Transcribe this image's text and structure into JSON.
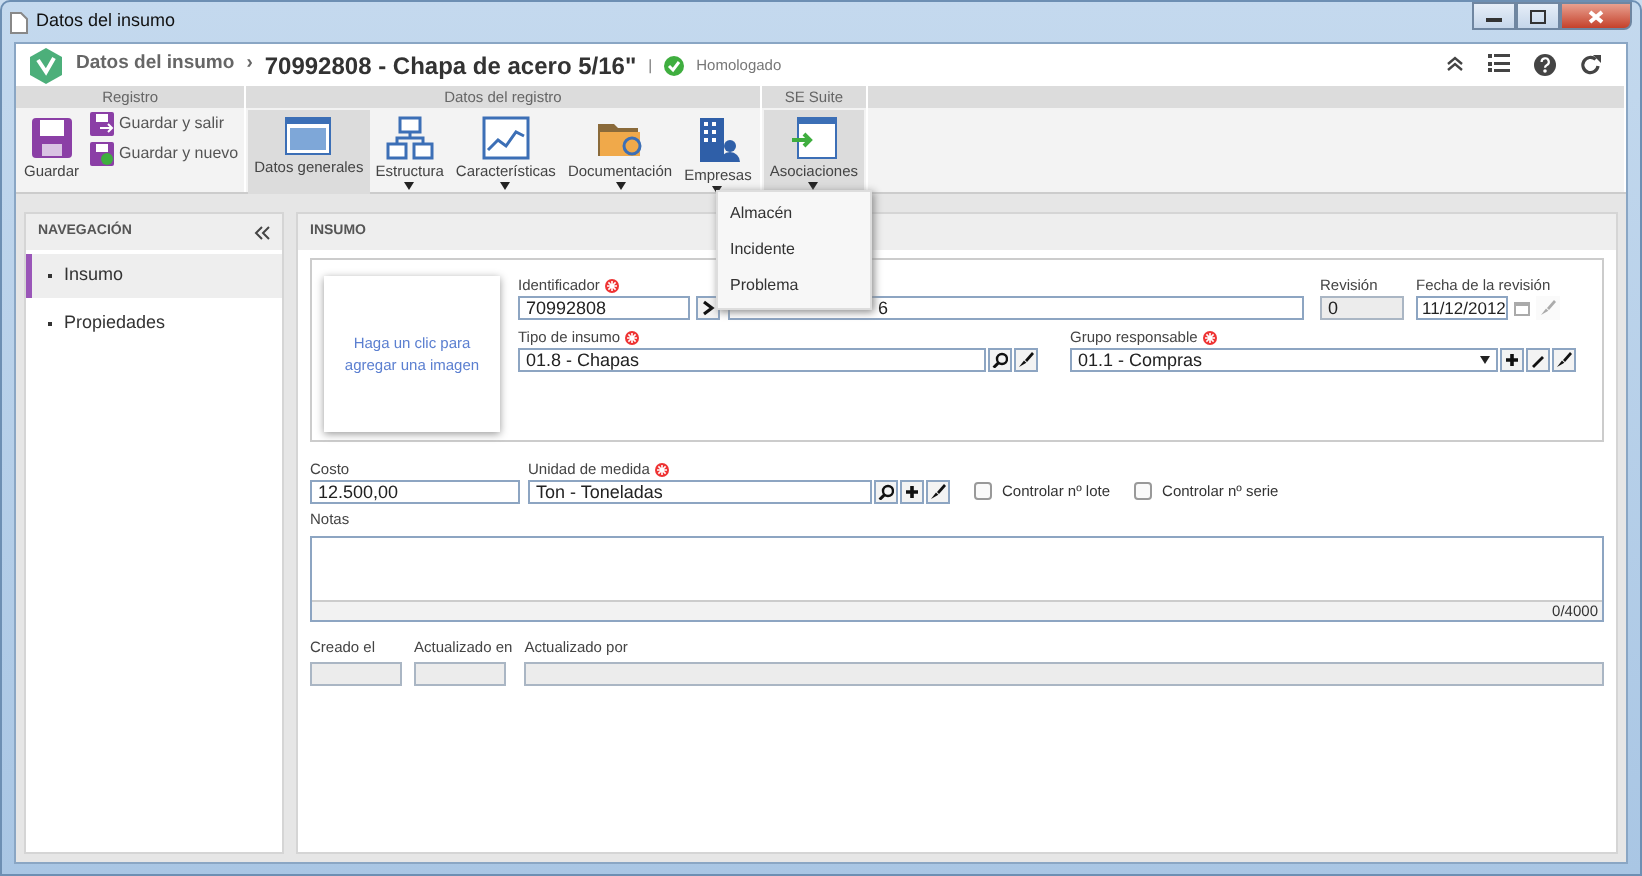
{
  "window": {
    "title": "Datos del insumo"
  },
  "header": {
    "breadcrumb": "Datos del insumo",
    "separator": "›",
    "title": "70992808 - Chapa de acero 5/16\"",
    "divider": "|",
    "status": "Homologado"
  },
  "ribbon": {
    "groups": [
      {
        "label": "Registro",
        "kind": "mixed",
        "buttons": [
          {
            "label": "Guardar",
            "selected": false
          },
          {
            "label": "Guardar y salir",
            "selected": false
          },
          {
            "label": "Guardar y nuevo",
            "selected": false
          }
        ]
      },
      {
        "label": "Datos del registro",
        "kind": "large",
        "buttons": [
          {
            "label": "Datos generales",
            "dropdown": false,
            "selected": true
          },
          {
            "label": "Estructura",
            "dropdown": true,
            "selected": false
          },
          {
            "label": "Características",
            "dropdown": true,
            "selected": false
          },
          {
            "label": "Documentación",
            "dropdown": true,
            "selected": false
          },
          {
            "label": "Empresas",
            "dropdown": true,
            "selected": false
          }
        ]
      },
      {
        "label": "SE Suite",
        "kind": "large",
        "buttons": [
          {
            "label": "Asociaciones",
            "dropdown": true,
            "selected": true
          }
        ]
      }
    ]
  },
  "dropdown_menu": {
    "items": [
      "Almacén",
      "Incidente",
      "Problema"
    ]
  },
  "navigation": {
    "title": "NAVEGACIÓN",
    "items": [
      {
        "label": "Insumo",
        "selected": true
      },
      {
        "label": "Propiedades",
        "selected": false
      }
    ]
  },
  "panel": {
    "title": "INSUMO",
    "image_hint": "Haga un clic para agregar una imagen",
    "identifier": {
      "label": "Identificador",
      "required": true,
      "value": "70992808"
    },
    "name": {
      "value": "6"
    },
    "revision": {
      "label": "Revisión",
      "value": "0"
    },
    "revision_date": {
      "label": "Fecha de la revisión",
      "value": "11/12/2012"
    },
    "type": {
      "label": "Tipo de insumo",
      "required": true,
      "value": "01.8 - Chapas"
    },
    "group": {
      "label": "Grupo responsable",
      "required": true,
      "value": "01.1 - Compras"
    },
    "cost": {
      "label": "Costo",
      "value": "12.500,00"
    },
    "unit": {
      "label": "Unidad de medida",
      "required": true,
      "value": "Ton - Toneladas"
    },
    "checkboxes": [
      {
        "label": "Controlar nº lote",
        "checked": false
      },
      {
        "label": "Controlar nº serie",
        "checked": false
      }
    ],
    "notes": {
      "label": "Notas",
      "counter": "0/4000"
    },
    "audit": [
      {
        "label": "Creado el"
      },
      {
        "label": "Actualizado en"
      },
      {
        "label": "Actualizado por"
      }
    ]
  }
}
